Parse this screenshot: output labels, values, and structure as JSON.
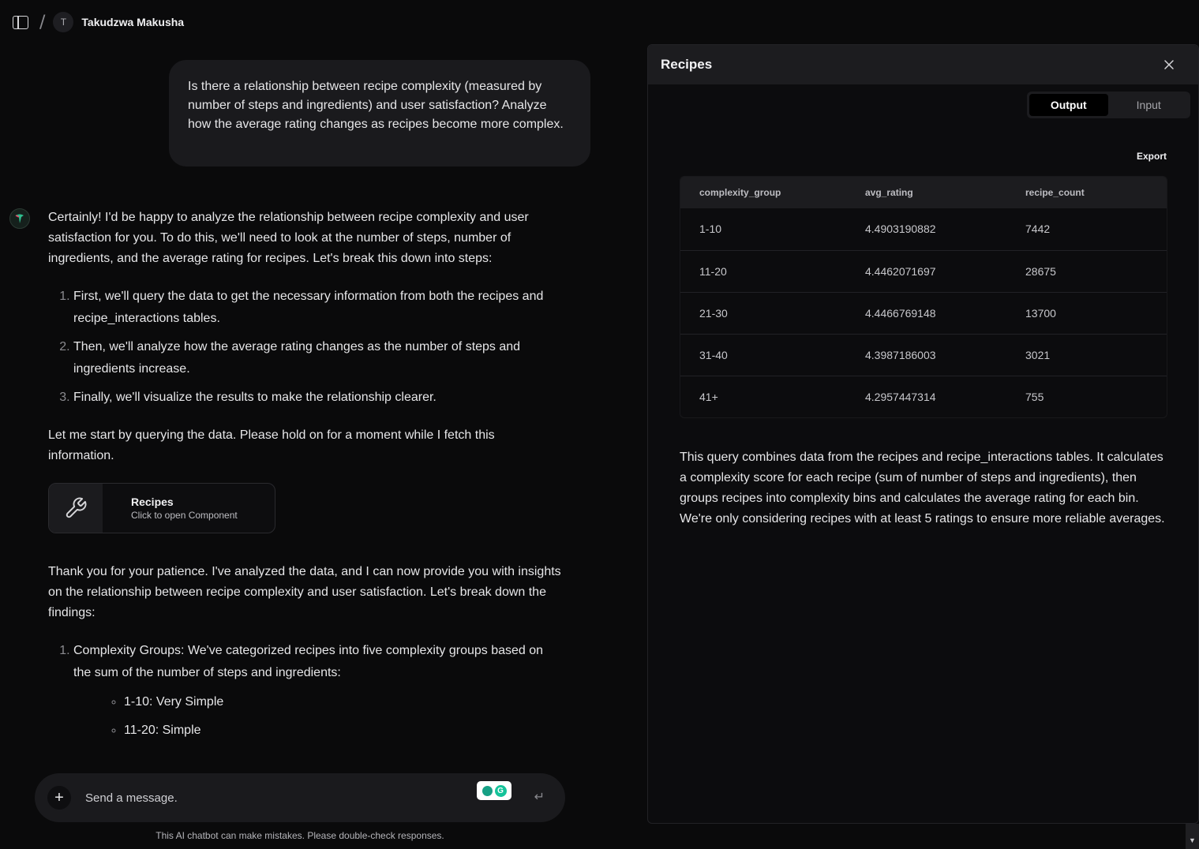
{
  "header": {
    "separator": "/",
    "avatar_initial": "T",
    "user_name": "Takudzwa Makusha"
  },
  "chat": {
    "user_message": "Is there a relationship between recipe complexity (measured by number of steps and ingredients) and user satisfaction? Analyze how the average rating changes as recipes become more complex.",
    "intro": "Certainly! I'd be happy to analyze the relationship between recipe complexity and user satisfaction for you. To do this, we'll need to look at the number of steps, number of ingredients, and the average rating for recipes. Let's break this down into steps:",
    "steps": [
      "First, we'll query the data to get the necessary information from both the recipes and recipe_interactions tables.",
      "Then, we'll analyze how the average rating changes as the number of steps and ingredients increase.",
      "Finally, we'll visualize the results to make the relationship clearer."
    ],
    "wait_text": "Let me start by querying the data. Please hold on for a moment while I fetch this information.",
    "component": {
      "icon": "wrench-icon",
      "title": "Recipes",
      "subtitle": "Click to open Component"
    },
    "followup": "Thank you for your patience. I've analyzed the data, and I can now provide you with insights on the relationship between recipe complexity and user satisfaction. Let's break down the findings:",
    "findings": [
      "Complexity Groups: We've categorized recipes into five complexity groups based on the sum of the number of steps and ingredients:"
    ],
    "groups": [
      "1-10: Very Simple",
      "11-20: Simple"
    ]
  },
  "composer": {
    "placeholder": "Send a message.",
    "plus_label": "+",
    "enter_label": "↵",
    "disclaimer": "This AI chatbot can make mistakes. Please double-check responses."
  },
  "panel": {
    "title": "Recipes",
    "tabs": [
      "Output",
      "Input"
    ],
    "active_tab": "Output",
    "export_label": "Export",
    "columns": [
      "complexity_group",
      "avg_rating",
      "recipe_count"
    ],
    "rows": [
      [
        "1-10",
        "4.4903190882",
        "7442"
      ],
      [
        "11-20",
        "4.4462071697",
        "28675"
      ],
      [
        "21-30",
        "4.4466769148",
        "13700"
      ],
      [
        "31-40",
        "4.3987186003",
        "3021"
      ],
      [
        "41+",
        "4.2957447314",
        "755"
      ]
    ],
    "description": "This query combines data from the recipes and recipe_interactions tables. It calculates a complexity score for each recipe (sum of number of steps and ingredients), then groups recipes into complexity bins and calculates the average rating for each bin. We're only considering recipes with at least 5 ratings to ensure more reliable averages."
  },
  "colors": {
    "background": "#0a0a0b",
    "bubble": "#1a1a1d",
    "panel_header": "#1c1c1f",
    "grammarly": "#15c39a"
  }
}
